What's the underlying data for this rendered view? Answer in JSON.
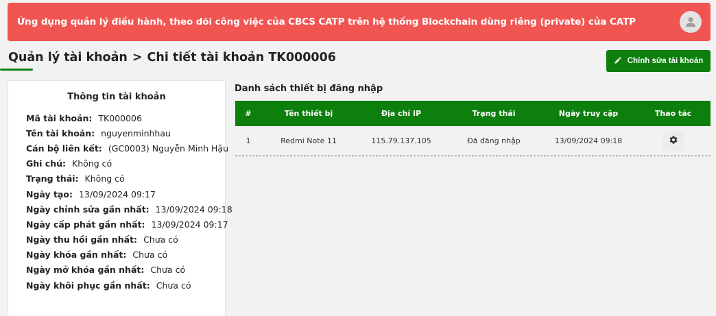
{
  "header": {
    "title": "Ứng dụng quản lý điều hành, theo dõi công việc của CBCS CATP trên hệ thống Blockchain dùng riêng (private) của CATP",
    "avatar_icon": "user-avatar-icon"
  },
  "breadcrumb": {
    "parent": "Quản lý tài khoản",
    "separator": ">",
    "current": "Chi tiết tài khoản TK000006"
  },
  "actions": {
    "edit_label": "Chỉnh sửa tài khoản",
    "edit_icon": "pencil-icon"
  },
  "account_info": {
    "title": "Thông tin tài khoản",
    "fields": [
      {
        "label": "Mã tài khoản:",
        "value": "TK000006"
      },
      {
        "label": "Tên tài khoản:",
        "value": "nguyenminhhau"
      },
      {
        "label": "Cán bộ liên kết:",
        "value": "(GC0003) Nguyễn Minh Hậu"
      },
      {
        "label": "Ghi chú:",
        "value": "Không có"
      },
      {
        "label": "Trạng thái:",
        "value": "Không có"
      },
      {
        "label": "Ngày tạo:",
        "value": "13/09/2024 09:17"
      },
      {
        "label": "Ngày chỉnh sửa gần nhất:",
        "value": "13/09/2024 09:18"
      },
      {
        "label": "Ngày cấp phát gần nhất:",
        "value": "13/09/2024 09:17"
      },
      {
        "label": "Ngày thu hồi gần nhất:",
        "value": "Chưa có"
      },
      {
        "label": "Ngày khóa gần nhất:",
        "value": "Chưa có"
      },
      {
        "label": "Ngày mở khóa gần nhất:",
        "value": "Chưa có"
      },
      {
        "label": "Ngày khôi phục gần nhất:",
        "value": "Chưa có"
      }
    ]
  },
  "devices": {
    "title": "Danh sách thiết bị đăng nhập",
    "columns": [
      "#",
      "Tên thiết bị",
      "Địa chỉ IP",
      "Trạng thái",
      "Ngày truy cập",
      "Thao tác"
    ],
    "rows": [
      {
        "index": "1",
        "device": "Redmi Note 11",
        "ip": "115.79.137.105",
        "status": "Đã đăng nhập",
        "accessed": "13/09/2024 09:18",
        "action_icon": "gear-icon"
      }
    ]
  },
  "colors": {
    "banner": "#f05552",
    "primary_green": "#0d7f0d"
  }
}
